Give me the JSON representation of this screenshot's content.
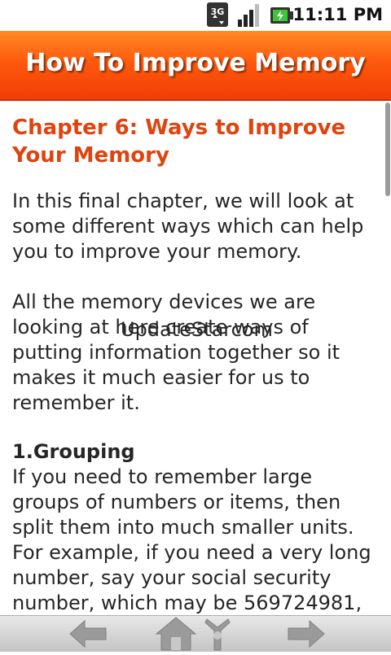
{
  "status_bar": {
    "network_label": "3G",
    "time": "11:11 PM",
    "icons": [
      "network-3g-icon",
      "signal-strength-icon",
      "battery-charging-icon"
    ]
  },
  "app": {
    "title": "How To Improve Memory",
    "accent_color": "#ff5a0e"
  },
  "content": {
    "chapter_title": "Chapter 6: Ways to Improve Your Memory",
    "paragraph_1": "In this final chapter, we will look at some different ways which can help you to improve your memory.",
    "paragraph_2": "All the memory devices we are looking at here create ways of putting information together so it makes it much easier for us to remember it.",
    "overlay_text": "UpdateStarcom",
    "section_heading": "1.Grouping",
    "paragraph_3": "If you need to remember large groups of numbers or items, then split them into much smaller units. For example, if you need a very long number, say your social security number, which may be 569724981,"
  },
  "bottom_nav": {
    "buttons": [
      "back-arrow-icon",
      "home-icon",
      "share-icon",
      "forward-arrow-icon"
    ]
  }
}
